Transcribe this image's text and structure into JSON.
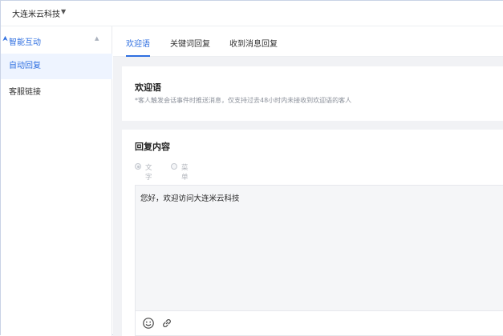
{
  "header": {
    "org_name": "大连米云科技",
    "caret_icon": "caret-down-icon"
  },
  "sidebar": {
    "group": {
      "label": "智能互动",
      "icon": "interaction-icon",
      "caret_icon": "caret-up-icon"
    },
    "items": [
      {
        "label": "自动回复",
        "active": true
      },
      {
        "label": "客服链接",
        "active": false
      }
    ]
  },
  "tabs": [
    {
      "label": "欢迎语",
      "active": true
    },
    {
      "label": "关键词回复",
      "active": false
    },
    {
      "label": "收到消息回复",
      "active": false
    }
  ],
  "welcome_card": {
    "title": "欢迎语",
    "description": "*客人触发会话事件时推送消息，仅支持过去48小时内未接收到欢迎语的客人"
  },
  "reply_card": {
    "title": "回复内容",
    "options": [
      {
        "label": "文字",
        "selected": true
      },
      {
        "label": "菜单",
        "selected": false
      }
    ],
    "editor_value": "您好，欢迎访问大连米云科技",
    "toolbar_icons": [
      "emoji-icon",
      "link-icon"
    ]
  },
  "colors": {
    "accent": "#2f6fe0",
    "content_bg": "#f1f2f5",
    "active_item_bg": "#eef4ff"
  }
}
